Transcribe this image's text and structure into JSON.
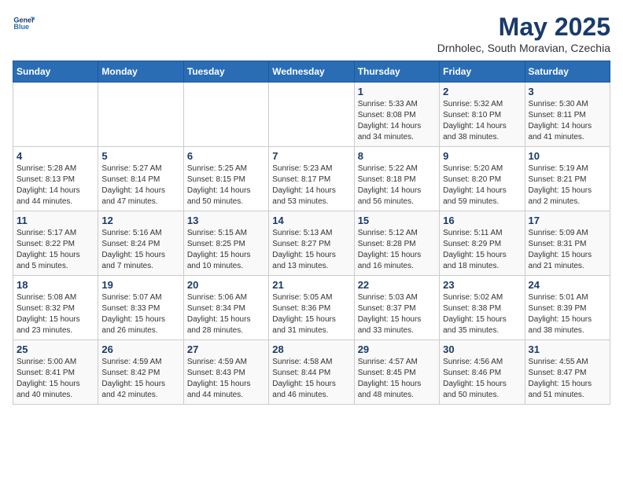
{
  "logo": {
    "line1": "General",
    "line2": "Blue"
  },
  "title": "May 2025",
  "subtitle": "Drnholec, South Moravian, Czechia",
  "days_header": [
    "Sunday",
    "Monday",
    "Tuesday",
    "Wednesday",
    "Thursday",
    "Friday",
    "Saturday"
  ],
  "weeks": [
    [
      {
        "day": "",
        "info": ""
      },
      {
        "day": "",
        "info": ""
      },
      {
        "day": "",
        "info": ""
      },
      {
        "day": "",
        "info": ""
      },
      {
        "day": "1",
        "info": "Sunrise: 5:33 AM\nSunset: 8:08 PM\nDaylight: 14 hours\nand 34 minutes."
      },
      {
        "day": "2",
        "info": "Sunrise: 5:32 AM\nSunset: 8:10 PM\nDaylight: 14 hours\nand 38 minutes."
      },
      {
        "day": "3",
        "info": "Sunrise: 5:30 AM\nSunset: 8:11 PM\nDaylight: 14 hours\nand 41 minutes."
      }
    ],
    [
      {
        "day": "4",
        "info": "Sunrise: 5:28 AM\nSunset: 8:13 PM\nDaylight: 14 hours\nand 44 minutes."
      },
      {
        "day": "5",
        "info": "Sunrise: 5:27 AM\nSunset: 8:14 PM\nDaylight: 14 hours\nand 47 minutes."
      },
      {
        "day": "6",
        "info": "Sunrise: 5:25 AM\nSunset: 8:15 PM\nDaylight: 14 hours\nand 50 minutes."
      },
      {
        "day": "7",
        "info": "Sunrise: 5:23 AM\nSunset: 8:17 PM\nDaylight: 14 hours\nand 53 minutes."
      },
      {
        "day": "8",
        "info": "Sunrise: 5:22 AM\nSunset: 8:18 PM\nDaylight: 14 hours\nand 56 minutes."
      },
      {
        "day": "9",
        "info": "Sunrise: 5:20 AM\nSunset: 8:20 PM\nDaylight: 14 hours\nand 59 minutes."
      },
      {
        "day": "10",
        "info": "Sunrise: 5:19 AM\nSunset: 8:21 PM\nDaylight: 15 hours\nand 2 minutes."
      }
    ],
    [
      {
        "day": "11",
        "info": "Sunrise: 5:17 AM\nSunset: 8:22 PM\nDaylight: 15 hours\nand 5 minutes."
      },
      {
        "day": "12",
        "info": "Sunrise: 5:16 AM\nSunset: 8:24 PM\nDaylight: 15 hours\nand 7 minutes."
      },
      {
        "day": "13",
        "info": "Sunrise: 5:15 AM\nSunset: 8:25 PM\nDaylight: 15 hours\nand 10 minutes."
      },
      {
        "day": "14",
        "info": "Sunrise: 5:13 AM\nSunset: 8:27 PM\nDaylight: 15 hours\nand 13 minutes."
      },
      {
        "day": "15",
        "info": "Sunrise: 5:12 AM\nSunset: 8:28 PM\nDaylight: 15 hours\nand 16 minutes."
      },
      {
        "day": "16",
        "info": "Sunrise: 5:11 AM\nSunset: 8:29 PM\nDaylight: 15 hours\nand 18 minutes."
      },
      {
        "day": "17",
        "info": "Sunrise: 5:09 AM\nSunset: 8:31 PM\nDaylight: 15 hours\nand 21 minutes."
      }
    ],
    [
      {
        "day": "18",
        "info": "Sunrise: 5:08 AM\nSunset: 8:32 PM\nDaylight: 15 hours\nand 23 minutes."
      },
      {
        "day": "19",
        "info": "Sunrise: 5:07 AM\nSunset: 8:33 PM\nDaylight: 15 hours\nand 26 minutes."
      },
      {
        "day": "20",
        "info": "Sunrise: 5:06 AM\nSunset: 8:34 PM\nDaylight: 15 hours\nand 28 minutes."
      },
      {
        "day": "21",
        "info": "Sunrise: 5:05 AM\nSunset: 8:36 PM\nDaylight: 15 hours\nand 31 minutes."
      },
      {
        "day": "22",
        "info": "Sunrise: 5:03 AM\nSunset: 8:37 PM\nDaylight: 15 hours\nand 33 minutes."
      },
      {
        "day": "23",
        "info": "Sunrise: 5:02 AM\nSunset: 8:38 PM\nDaylight: 15 hours\nand 35 minutes."
      },
      {
        "day": "24",
        "info": "Sunrise: 5:01 AM\nSunset: 8:39 PM\nDaylight: 15 hours\nand 38 minutes."
      }
    ],
    [
      {
        "day": "25",
        "info": "Sunrise: 5:00 AM\nSunset: 8:41 PM\nDaylight: 15 hours\nand 40 minutes."
      },
      {
        "day": "26",
        "info": "Sunrise: 4:59 AM\nSunset: 8:42 PM\nDaylight: 15 hours\nand 42 minutes."
      },
      {
        "day": "27",
        "info": "Sunrise: 4:59 AM\nSunset: 8:43 PM\nDaylight: 15 hours\nand 44 minutes."
      },
      {
        "day": "28",
        "info": "Sunrise: 4:58 AM\nSunset: 8:44 PM\nDaylight: 15 hours\nand 46 minutes."
      },
      {
        "day": "29",
        "info": "Sunrise: 4:57 AM\nSunset: 8:45 PM\nDaylight: 15 hours\nand 48 minutes."
      },
      {
        "day": "30",
        "info": "Sunrise: 4:56 AM\nSunset: 8:46 PM\nDaylight: 15 hours\nand 50 minutes."
      },
      {
        "day": "31",
        "info": "Sunrise: 4:55 AM\nSunset: 8:47 PM\nDaylight: 15 hours\nand 51 minutes."
      }
    ]
  ]
}
